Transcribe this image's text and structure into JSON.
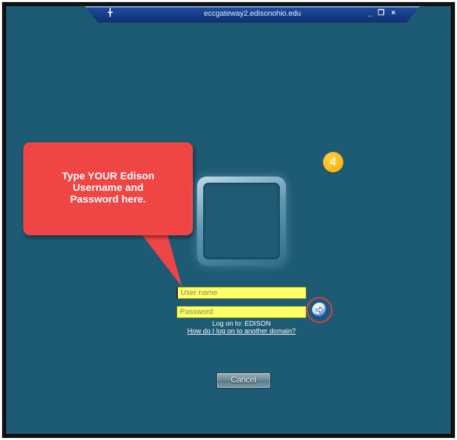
{
  "connection_bar": {
    "title": "eccgateway2.edisonohio.edu",
    "pin_icon": "pin-icon",
    "minimize_label": "_",
    "restore_label": "❐",
    "close_label": "×"
  },
  "callout": {
    "text": "Type YOUR Edison\nUsername and\nPassword here."
  },
  "step_badge": "4",
  "login": {
    "username_placeholder": "User name",
    "password_placeholder": "Password",
    "logon_to": "Log on to: EDISON",
    "domain_link": "How do I log on to another domain?",
    "cancel_label": "Cancel",
    "go_icon": "arrow-right-icon"
  },
  "colors": {
    "background": "#1d5a74",
    "callout": "#f04545",
    "field": "#ffff66",
    "badge": "#f2a400"
  }
}
